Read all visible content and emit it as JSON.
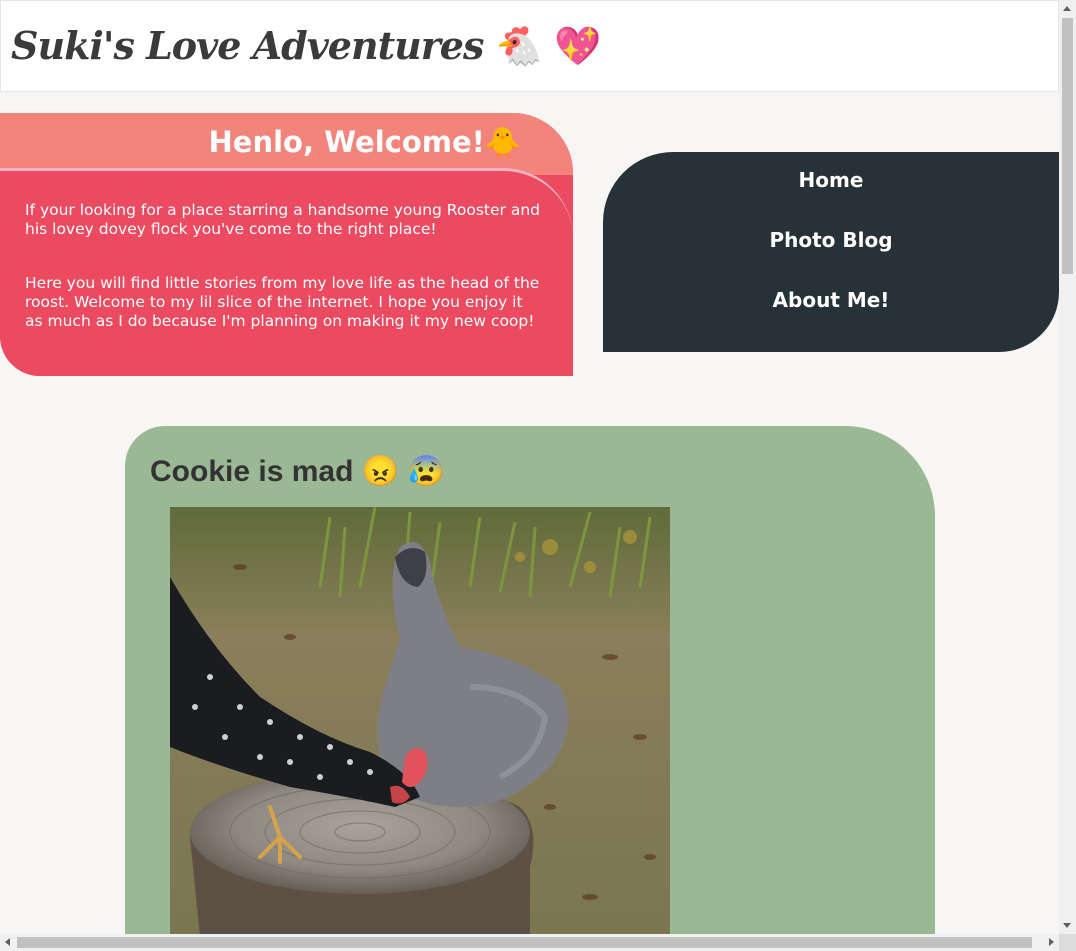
{
  "header": {
    "title": "Suki's Love Adventures",
    "title_emoji": "🐔 💖"
  },
  "welcome": {
    "title": "Henlo, Welcome!",
    "title_emoji": "🐥",
    "paragraphs": [
      "If your looking for a place starring a handsome young Rooster and his lovey dovey flock you've come to the right place!",
      "Here you will find little stories from my love life as the head of the roost. Welcome to my lil slice of the internet. I hope you enjoy it as much as I do because I'm planning on making it my new coop!"
    ]
  },
  "nav": {
    "items": [
      "Home",
      "Photo Blog",
      "About Me!"
    ]
  },
  "post": {
    "title": "Cookie is mad",
    "title_emoji": "😠 😰",
    "photo_alt": "Two chickens standing on a tree stump"
  },
  "colors": {
    "page_bg": "#f7f6f4",
    "welcome_head": "#f2847b",
    "welcome_body": "#ec4a60",
    "nav_bg": "#263238",
    "post_bg": "#9bb895"
  }
}
